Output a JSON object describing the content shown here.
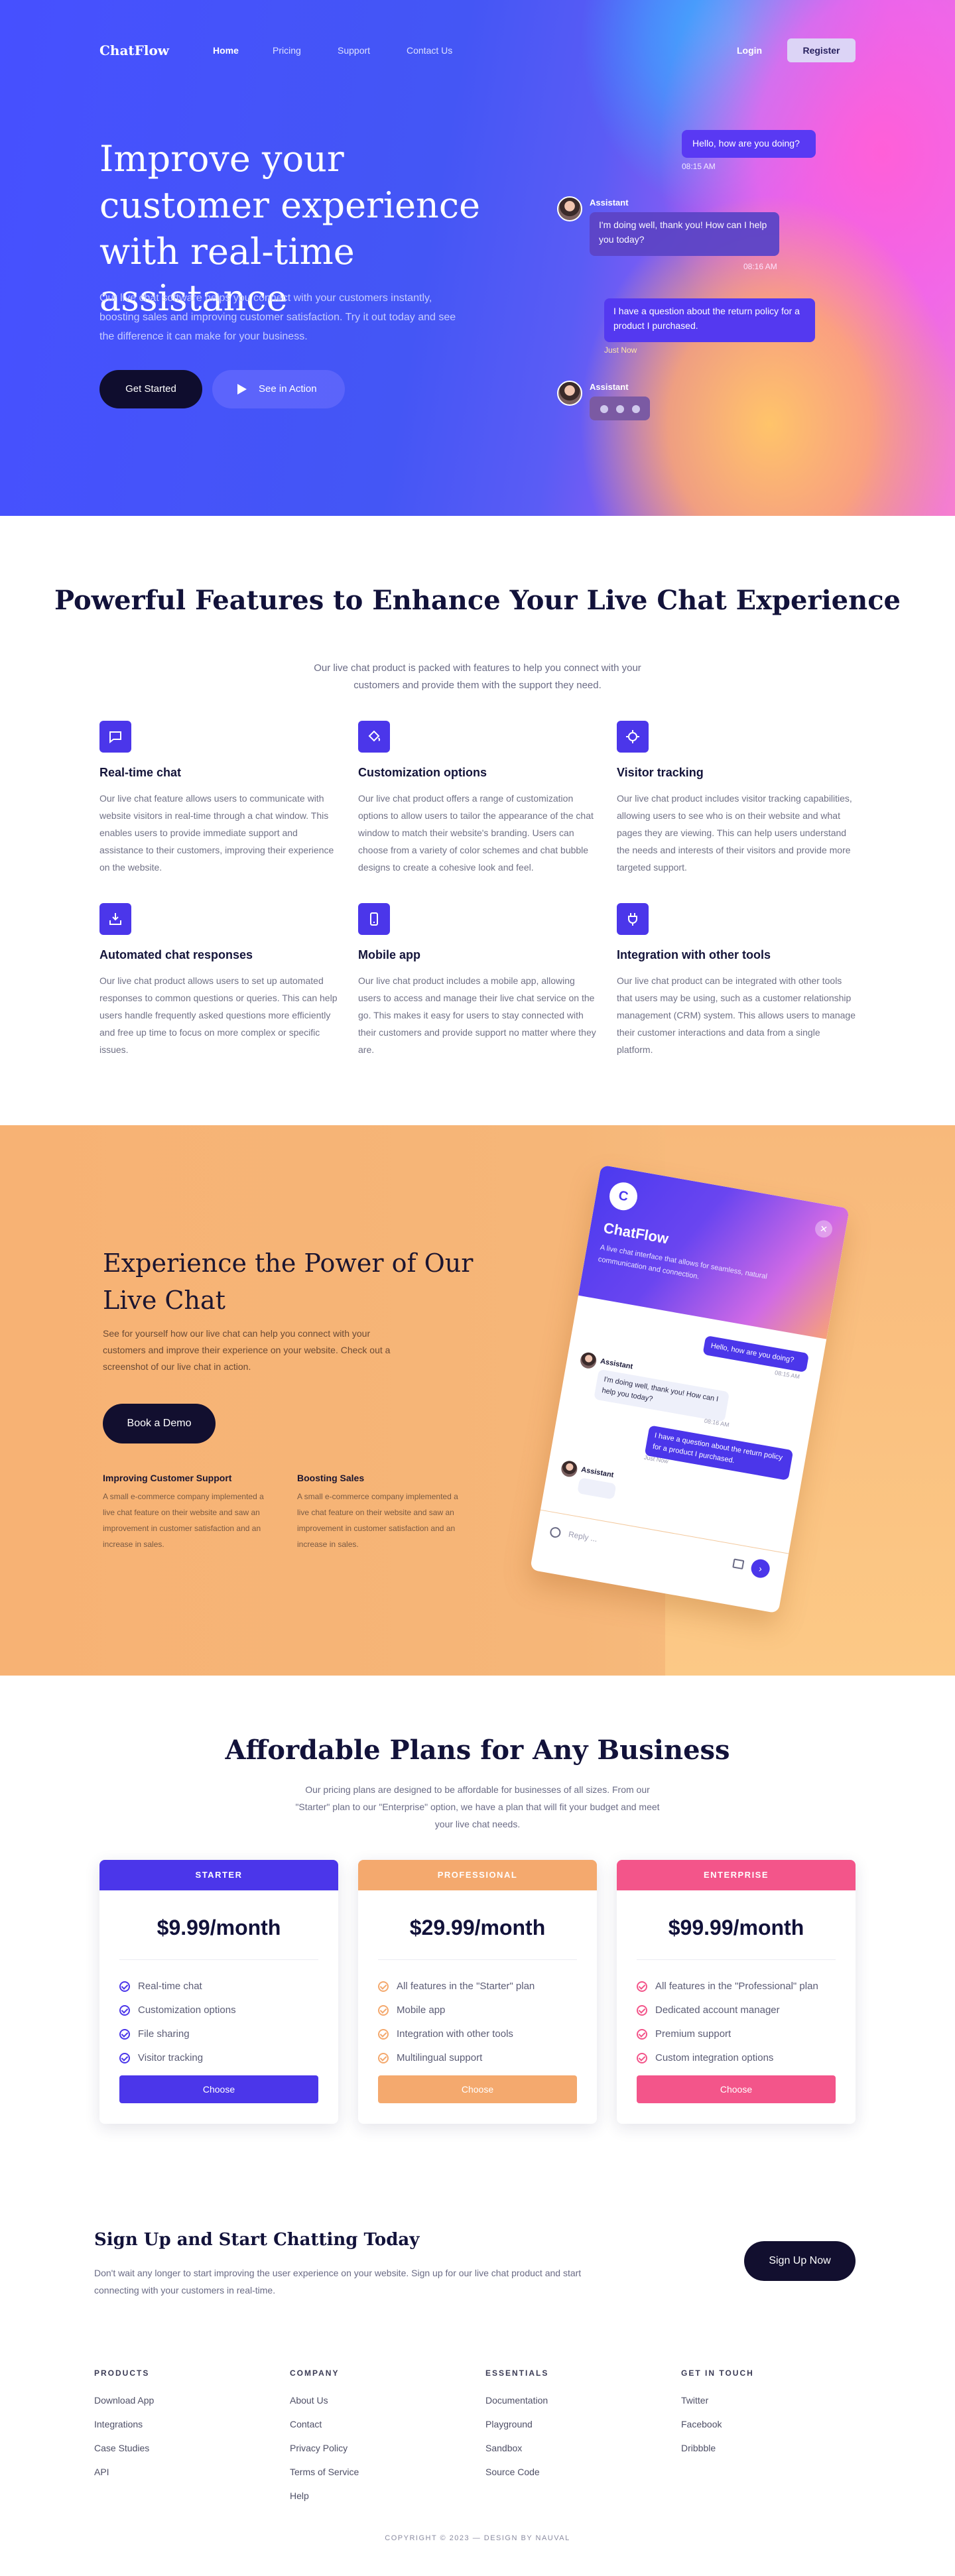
{
  "nav": {
    "logo": "ChatFlow",
    "links": [
      "Home",
      "Pricing",
      "Support",
      "Contact Us"
    ],
    "login": "Login",
    "register": "Register"
  },
  "hero": {
    "title": "Improve your customer experience with real-time assistance",
    "text": "Our live chat software helps you connect with your customers instantly, boosting sales and improving customer satisfaction. Try it out today and see the difference it can make for your business.",
    "start": "Get Started",
    "see": "See in Action",
    "chat": {
      "m1": "Hello, how are you doing?",
      "t1": "08:15 AM",
      "assistant": "Assistant",
      "m2": "I'm doing well, thank you! How can I help you today?",
      "t2": "08:16 AM",
      "m3": "I have a question about the return policy for a product I purchased.",
      "t3": "Just Now"
    }
  },
  "features": {
    "title": "Powerful Features to Enhance Your Live Chat Experience",
    "subtitle": "Our live chat product is packed with features to help you connect with your customers and provide them with the support they need.",
    "items": [
      {
        "title": "Real-time chat",
        "text": "Our live chat feature allows users to communicate with website visitors in real-time through a chat window. This enables users to provide immediate support and assistance to their customers, improving their experience on the website.",
        "icon": "chat-icon"
      },
      {
        "title": "Customization options",
        "text": "Our live chat product offers a range of customization options to allow users to tailor the appearance of the chat window to match their website's branding. Users can choose from a variety of color schemes and chat bubble designs to create a cohesive look and feel.",
        "icon": "paint-bucket-icon"
      },
      {
        "title": "Visitor tracking",
        "text": "Our live chat product includes visitor tracking capabilities, allowing users to see who is on their website and what pages they are viewing. This can help users understand the needs and interests of their visitors and provide more targeted support.",
        "icon": "crosshair-icon"
      },
      {
        "title": "Automated chat responses",
        "text": "Our live chat product allows users to set up automated responses to common questions or queries. This can help users handle frequently asked questions more efficiently and free up time to focus on more complex or specific issues.",
        "icon": "inbox-icon"
      },
      {
        "title": "Mobile app",
        "text": "Our live chat product includes a mobile app, allowing users to access and manage their live chat service on the go. This makes it easy for users to stay connected with their customers and provide support no matter where they are.",
        "icon": "mobile-icon"
      },
      {
        "title": "Integration with other tools",
        "text": "Our live chat product can be integrated with other tools that users may be using, such as a customer relationship management (CRM) system. This allows users to manage their customer interactions and data from a single platform.",
        "icon": "plug-icon"
      }
    ]
  },
  "demo": {
    "title": "Experience the Power of Our Live Chat",
    "text": "See for yourself how our live chat can help you connect with your customers and improve their experience on your website. Check out a screenshot of our live chat in action.",
    "button": "Book a Demo",
    "cases": [
      {
        "title": "Improving Customer Support",
        "text": "A small e-commerce company implemented a live chat feature on their website and saw an improvement in customer satisfaction and an increase in sales."
      },
      {
        "title": "Boosting Sales",
        "text": "A small e-commerce company implemented a live chat feature on their website and saw an improvement in customer satisfaction and an increase in sales."
      }
    ],
    "widget": {
      "logo": "C",
      "title": "ChatFlow",
      "subtitle": "A live chat interface that allows for seamless, natural communication and connection.",
      "m1": "Hello, how are you doing?",
      "t1": "08:15 AM",
      "assistant": "Assistant",
      "m2": "I'm doing well, thank you! How can I help you today?",
      "t2": "08:16 AM",
      "m3": "I have a question about the return policy for a product I purchased.",
      "t3": "Just Now",
      "placeholder": "Reply ..."
    }
  },
  "pricing": {
    "title": "Affordable Plans for Any Business",
    "subtitle": "Our pricing plans are designed to be affordable for businesses of all sizes. From our \"Starter\" plan to our \"Enterprise\" option, we have a plan that will fit your budget and meet your live chat needs.",
    "plans": [
      {
        "name": "STARTER",
        "price": "$9.99/month",
        "color": "#4b36ea",
        "features": [
          "Real-time chat",
          "Customization options",
          "File sharing",
          "Visitor tracking"
        ],
        "button": "Choose"
      },
      {
        "name": "PROFESSIONAL",
        "price": "$29.99/month",
        "color": "#f4a96e",
        "features": [
          "All features in the \"Starter\" plan",
          "Mobile app",
          "Integration with other tools",
          "Multilingual support"
        ],
        "button": "Choose"
      },
      {
        "name": "ENTERPRISE",
        "price": "$99.99/month",
        "color": "#f3558a",
        "features": [
          "All features in the \"Professional\" plan",
          "Dedicated account manager",
          "Premium support",
          "Custom integration options"
        ],
        "button": "Choose"
      }
    ]
  },
  "cta": {
    "title": "Sign Up and Start Chatting Today",
    "text": "Don't wait any longer to start improving the user experience on your website. Sign up for our live chat product and start connecting with your customers in real-time.",
    "button": "Sign Up Now"
  },
  "footer": {
    "cols": [
      {
        "title": "PRODUCTS",
        "links": [
          "Download App",
          "Integrations",
          "Case Studies",
          "API"
        ]
      },
      {
        "title": "COMPANY",
        "links": [
          "About Us",
          "Contact",
          "Privacy Policy",
          "Terms of Service",
          "Help"
        ]
      },
      {
        "title": "ESSENTIALS",
        "links": [
          "Documentation",
          "Playground",
          "Sandbox",
          "Source Code"
        ]
      },
      {
        "title": "GET IN TOUCH",
        "links": [
          "Twitter",
          "Facebook",
          "Dribbble"
        ]
      }
    ],
    "copyright": "COPYRIGHT © 2023 — DESIGN BY NAUVAL"
  }
}
